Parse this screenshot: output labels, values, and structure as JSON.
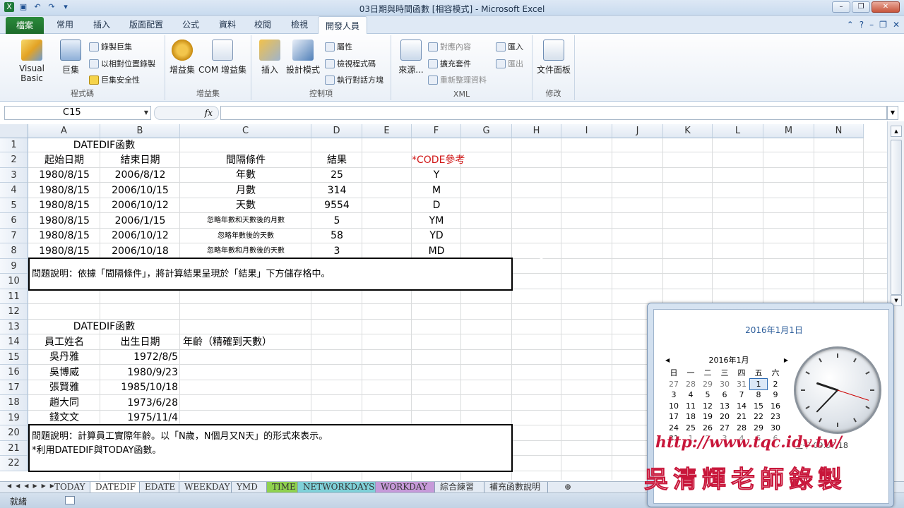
{
  "window": {
    "title": "03日期與時間函數 [相容模式] - Microsoft Excel"
  },
  "ribbon_tabs": {
    "file": "檔案",
    "home": "常用",
    "insert": "插入",
    "layout": "版面配置",
    "formulas": "公式",
    "data": "資料",
    "review": "校閱",
    "view": "檢視",
    "developer": "開發人員"
  },
  "ribbon": {
    "code": {
      "label": "程式碼",
      "visual_basic": "Visual Basic",
      "macros": "巨集",
      "record_macro": "錄製巨集",
      "relative_ref": "以相對位置錄製",
      "macro_security": "巨集安全性"
    },
    "addins": {
      "label": "增益集",
      "addins": "增益集",
      "com_addins": "COM 增益集"
    },
    "controls": {
      "label": "控制項",
      "insert": "插入",
      "design_mode": "設計模式",
      "properties": "屬性",
      "view_code": "檢視程式碼",
      "run_dialog": "執行對話方塊"
    },
    "xml": {
      "label": "XML",
      "source": "來源...",
      "map_props": "對應內容",
      "expansion": "擴充套件",
      "refresh": "重新整理資料",
      "import": "匯入",
      "export": "匯出"
    },
    "modify": {
      "label": "修改",
      "doc_panel": "文件面板"
    }
  },
  "formula_bar": {
    "name_box": "C15",
    "fx": "fx",
    "value": ""
  },
  "columns": [
    "A",
    "B",
    "C",
    "D",
    "E",
    "F",
    "G",
    "H",
    "I",
    "J",
    "K",
    "L",
    "M",
    "N"
  ],
  "rows": [
    "1",
    "2",
    "3",
    "4",
    "5",
    "6",
    "7",
    "8",
    "9",
    "10",
    "11",
    "12",
    "13",
    "14",
    "15",
    "16",
    "17",
    "18",
    "19",
    "20",
    "21",
    "22"
  ],
  "table1": {
    "title": "DATEDIF函數",
    "headers": {
      "start": "起始日期",
      "end": "結束日期",
      "cond": "間隔條件",
      "result": "結果",
      "code": "*CODE參考"
    },
    "rows": [
      {
        "start": "1980/8/15",
        "end": "2006/8/12",
        "cond": "年數",
        "result": "25",
        "code": "Y"
      },
      {
        "start": "1980/8/15",
        "end": "2006/10/15",
        "cond": "月數",
        "result": "314",
        "code": "M"
      },
      {
        "start": "1980/8/15",
        "end": "2006/10/12",
        "cond": "天數",
        "result": "9554",
        "code": "D"
      },
      {
        "start": "1980/8/15",
        "end": "2006/1/15",
        "cond": "忽略年數和天數後的月數",
        "result": "5",
        "code": "YM"
      },
      {
        "start": "1980/8/15",
        "end": "2006/10/12",
        "cond": "忽略年數後的天數",
        "result": "58",
        "code": "YD"
      },
      {
        "start": "1980/8/15",
        "end": "2006/10/18",
        "cond": "忽略年數和月數後的天數",
        "result": "3",
        "code": "MD"
      }
    ],
    "note": "問題說明：依據「間隔條件」，將計算結果呈現於「結果」下方儲存格中。"
  },
  "table2": {
    "title": "DATEDIF函數",
    "headers": {
      "name": "員工姓名",
      "birth": "出生日期",
      "age": "年齡（精確到天數）"
    },
    "rows": [
      {
        "name": "吳丹雅",
        "birth": "1972/8/5"
      },
      {
        "name": "吳博威",
        "birth": "1980/9/23"
      },
      {
        "name": "張賢雅",
        "birth": "1985/10/18"
      },
      {
        "name": "趙大同",
        "birth": "1973/6/28"
      },
      {
        "name": "錢文文",
        "birth": "1975/11/4"
      }
    ],
    "note1": "問題說明：計算員工實際年齡。以「N歲，N個月又N天」的形式來表示。",
    "note2": "*利用DATEDIF與TODAY函數。"
  },
  "sheet_tabs": [
    "TODAY",
    "DATEDIF",
    "EDATE",
    "WEEKDAY",
    "YMD",
    "TIME",
    "NETWORKDAYS",
    "WORKDAY",
    "綜合練習",
    "補充函數說明"
  ],
  "sheet_tab_colors": {
    "TIME": "#8fd14f",
    "NETWORKDAYS": "#7fd0d8",
    "WORKDAY": "#c69ad9"
  },
  "status": {
    "ready": "就緒"
  },
  "calendar": {
    "date_header": "2016年1月1日",
    "month_label": "2016年1月",
    "weekdays": [
      "日",
      "一",
      "二",
      "三",
      "四",
      "五",
      "六"
    ],
    "days": [
      [
        "27",
        "28",
        "29",
        "30",
        "31",
        "1",
        "2"
      ],
      [
        "3",
        "4",
        "5",
        "6",
        "7",
        "8",
        "9"
      ],
      [
        "10",
        "11",
        "12",
        "13",
        "14",
        "15",
        "16"
      ],
      [
        "17",
        "18",
        "19",
        "20",
        "21",
        "22",
        "23"
      ],
      [
        "24",
        "25",
        "26",
        "27",
        "28",
        "29",
        "30"
      ],
      [
        "31",
        "1",
        "2",
        "3",
        "4",
        "5",
        "6"
      ]
    ],
    "time": "上午 09:37:18"
  },
  "clock": {
    "hour": 9,
    "minute": 37,
    "second": 18
  },
  "watermark": {
    "url": "http://www.tqc.idv.tw/",
    "author": "吳清輝老師錄製"
  }
}
